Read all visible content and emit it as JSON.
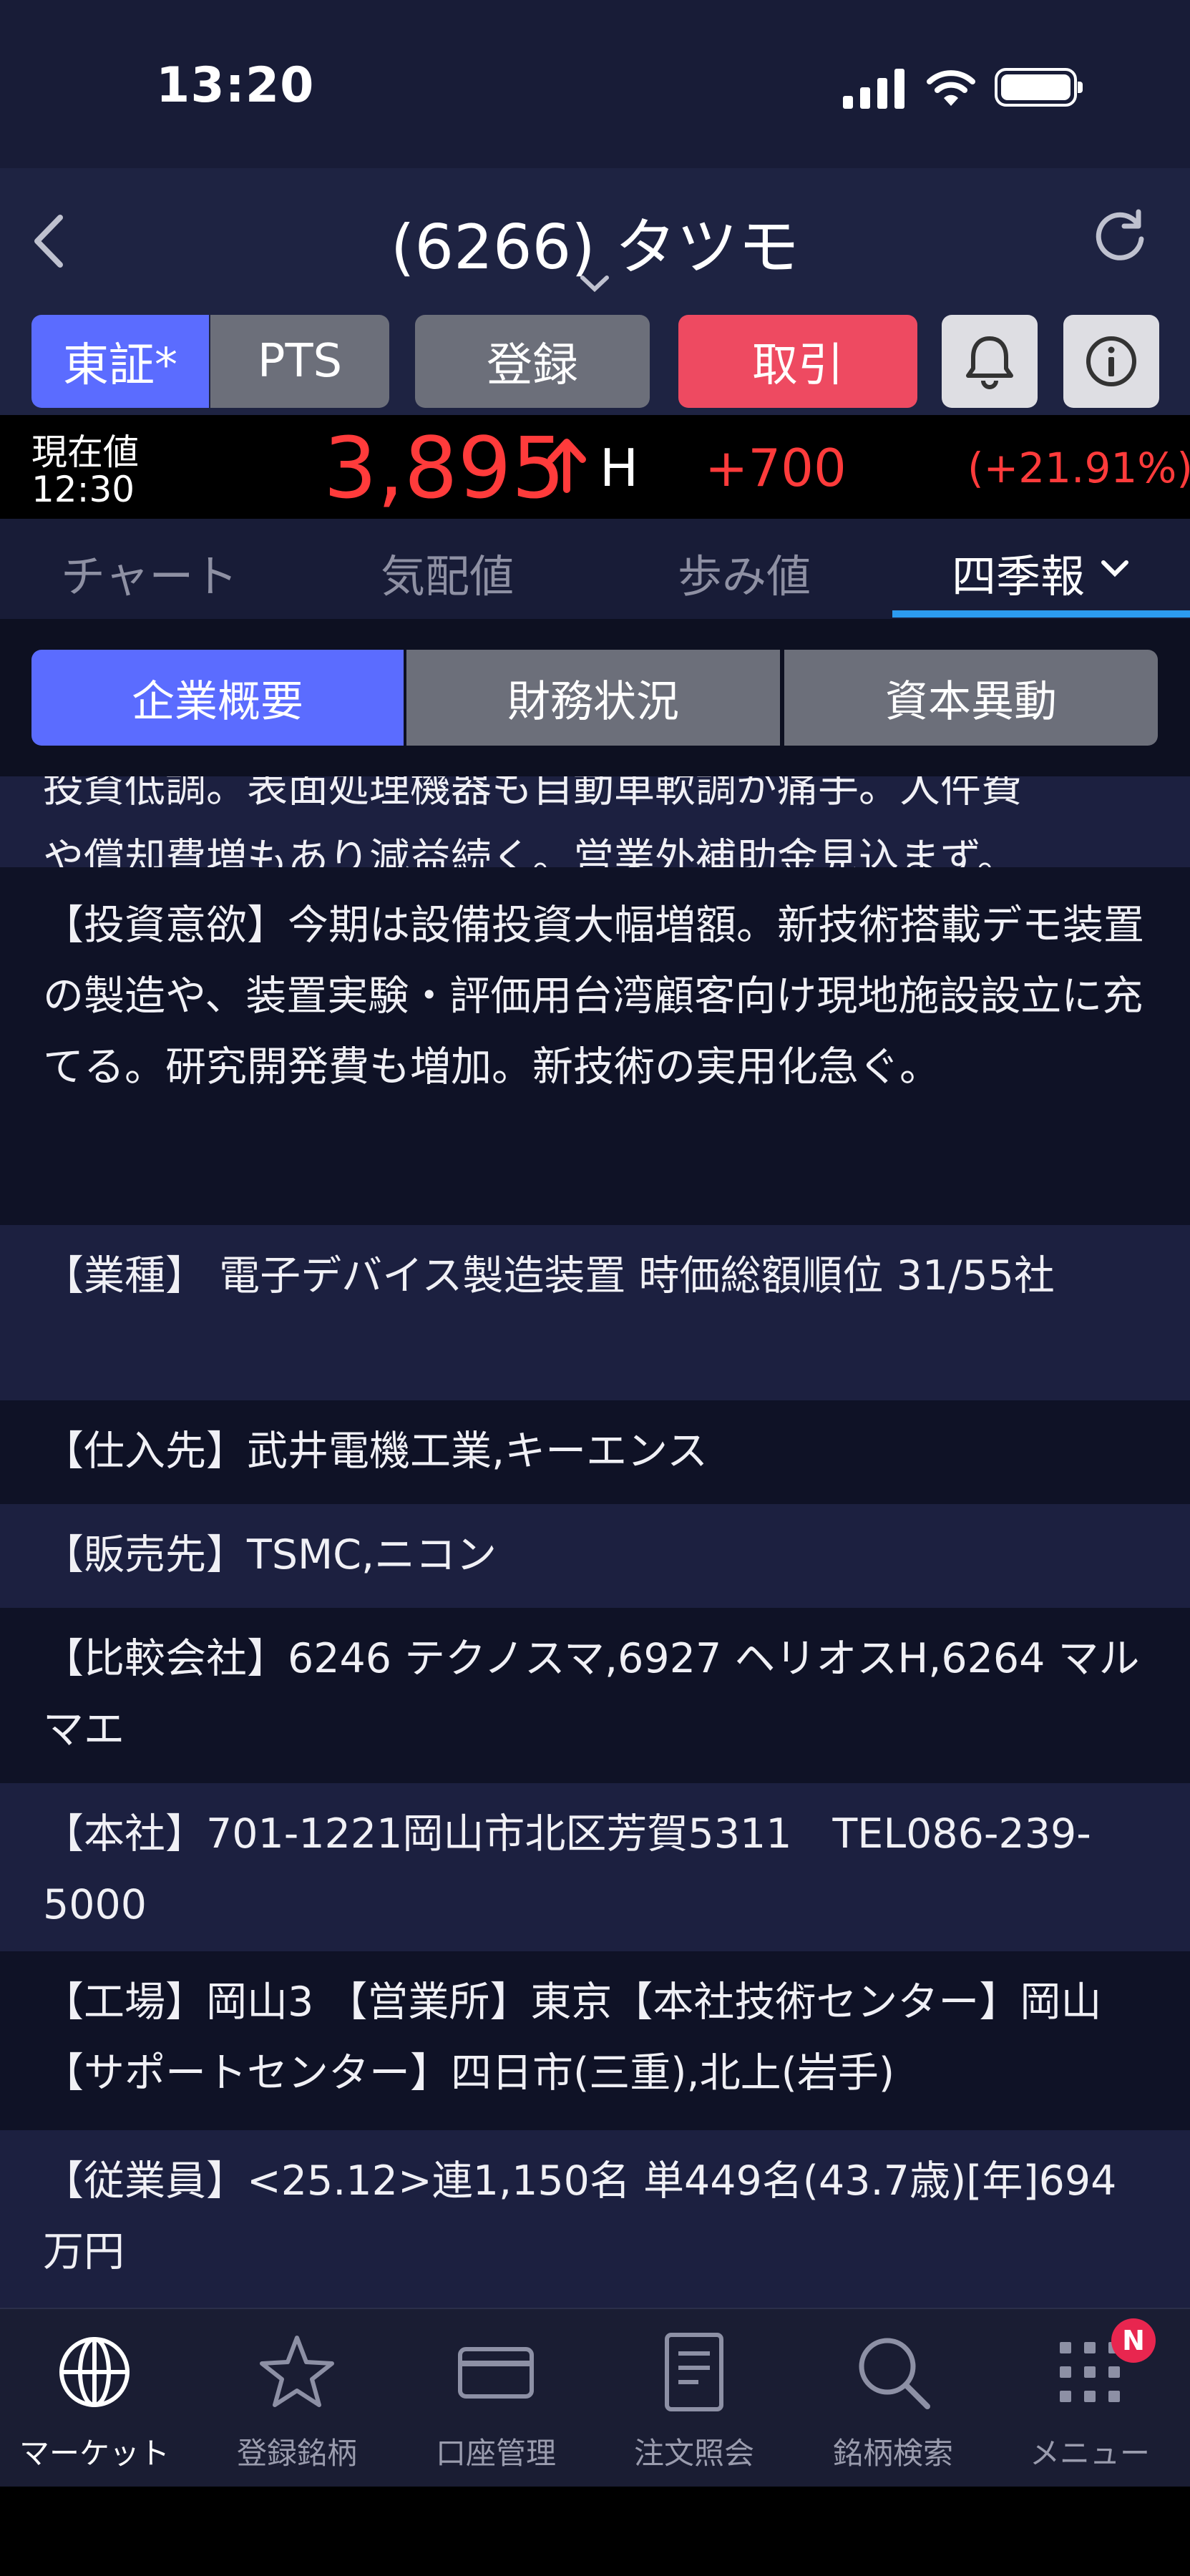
{
  "status_bar": {
    "time": "13:20"
  },
  "nav": {
    "title": "(6266) タツモ"
  },
  "buttons": {
    "tosho": "東証*",
    "pts": "PTS",
    "touroku": "登録",
    "torihiki": "取引"
  },
  "price": {
    "label": "現在値",
    "time": "12:30",
    "value": "3,895",
    "marker": "H",
    "change": "+700",
    "change_pct": "(+21.91%)",
    "color_up": "#ff3b3b"
  },
  "tabs": [
    "チャート",
    "気配値",
    "歩み値",
    "四季報"
  ],
  "active_tab": "四季報",
  "sub_tabs": [
    "企業概要",
    "財務状況",
    "資本異動"
  ],
  "active_sub_tab": "企業概要",
  "content": [
    "投資低調。表面処理機器も自動車軟調が痛手。人件費",
    "や償却費増もあり減益続く。営業外補助金見込まず。",
    "【投資意欲】今期は設備投資大幅増額。新技術搭載デモ装置の製造や、装置実験・評価用台湾顧客向け現地施設設立に充てる。研究開発費も増加。新技術の実用化急ぐ。",
    "【業種】 電子デバイス製造装置 時価総額順位 31/55社",
    "【仕入先】武井電機工業,キーエンス",
    "【販売先】TSMC,ニコン",
    "【比較会社】6246 テクノスマ,6927 ヘリオスH,6264 マルマエ",
    "【本社】701-1221岡山市北区芳賀5311　TEL086-239-5000",
    "【工場】岡山3 【営業所】東京【本社技術センター】岡山【サポートセンター】四日市(三重),北上(岩手)",
    "【従業員】<25.12>連1,150名 単449名(43.7歳)[年]694万円"
  ],
  "bottom_nav": [
    {
      "label": "マーケット",
      "icon": "globe-icon"
    },
    {
      "label": "登録銘柄",
      "icon": "star-icon"
    },
    {
      "label": "口座管理",
      "icon": "card-icon"
    },
    {
      "label": "注文照会",
      "icon": "document-icon"
    },
    {
      "label": "銘柄検索",
      "icon": "search-icon"
    },
    {
      "label": "メニュー",
      "icon": "grid-icon"
    }
  ],
  "menu_badge": "N",
  "colors": {
    "accent": "#5b6cff",
    "trade": "#ee4a61",
    "tab_underline": "#2c9bf0"
  }
}
